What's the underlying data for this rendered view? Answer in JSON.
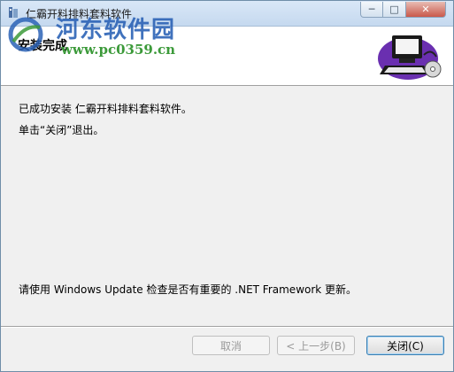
{
  "window": {
    "title": "仁霸开料排料套料软件",
    "controls": {
      "minimize": "─",
      "maximize": "□",
      "close": "✕"
    }
  },
  "watermark": {
    "site_name": "河东软件园",
    "url": "www.pc0359.cn"
  },
  "header": {
    "title": "安装完成",
    "icon": "computer-cd-icon"
  },
  "content": {
    "line1": "已成功安装 仁霸开料排料套料软件。",
    "line2": "单击“关闭”退出。",
    "line3": "请使用 Windows Update 检查是否有重要的 .NET Framework 更新。"
  },
  "buttons": {
    "cancel": "取消",
    "back": "< 上一步(B)",
    "close": "关闭(C)"
  },
  "colors": {
    "titlebar": "#c5d9ef",
    "watermark_blue": "#2c63b6",
    "watermark_green": "#3c9a3a",
    "body_bg": "#f0f0f0"
  }
}
